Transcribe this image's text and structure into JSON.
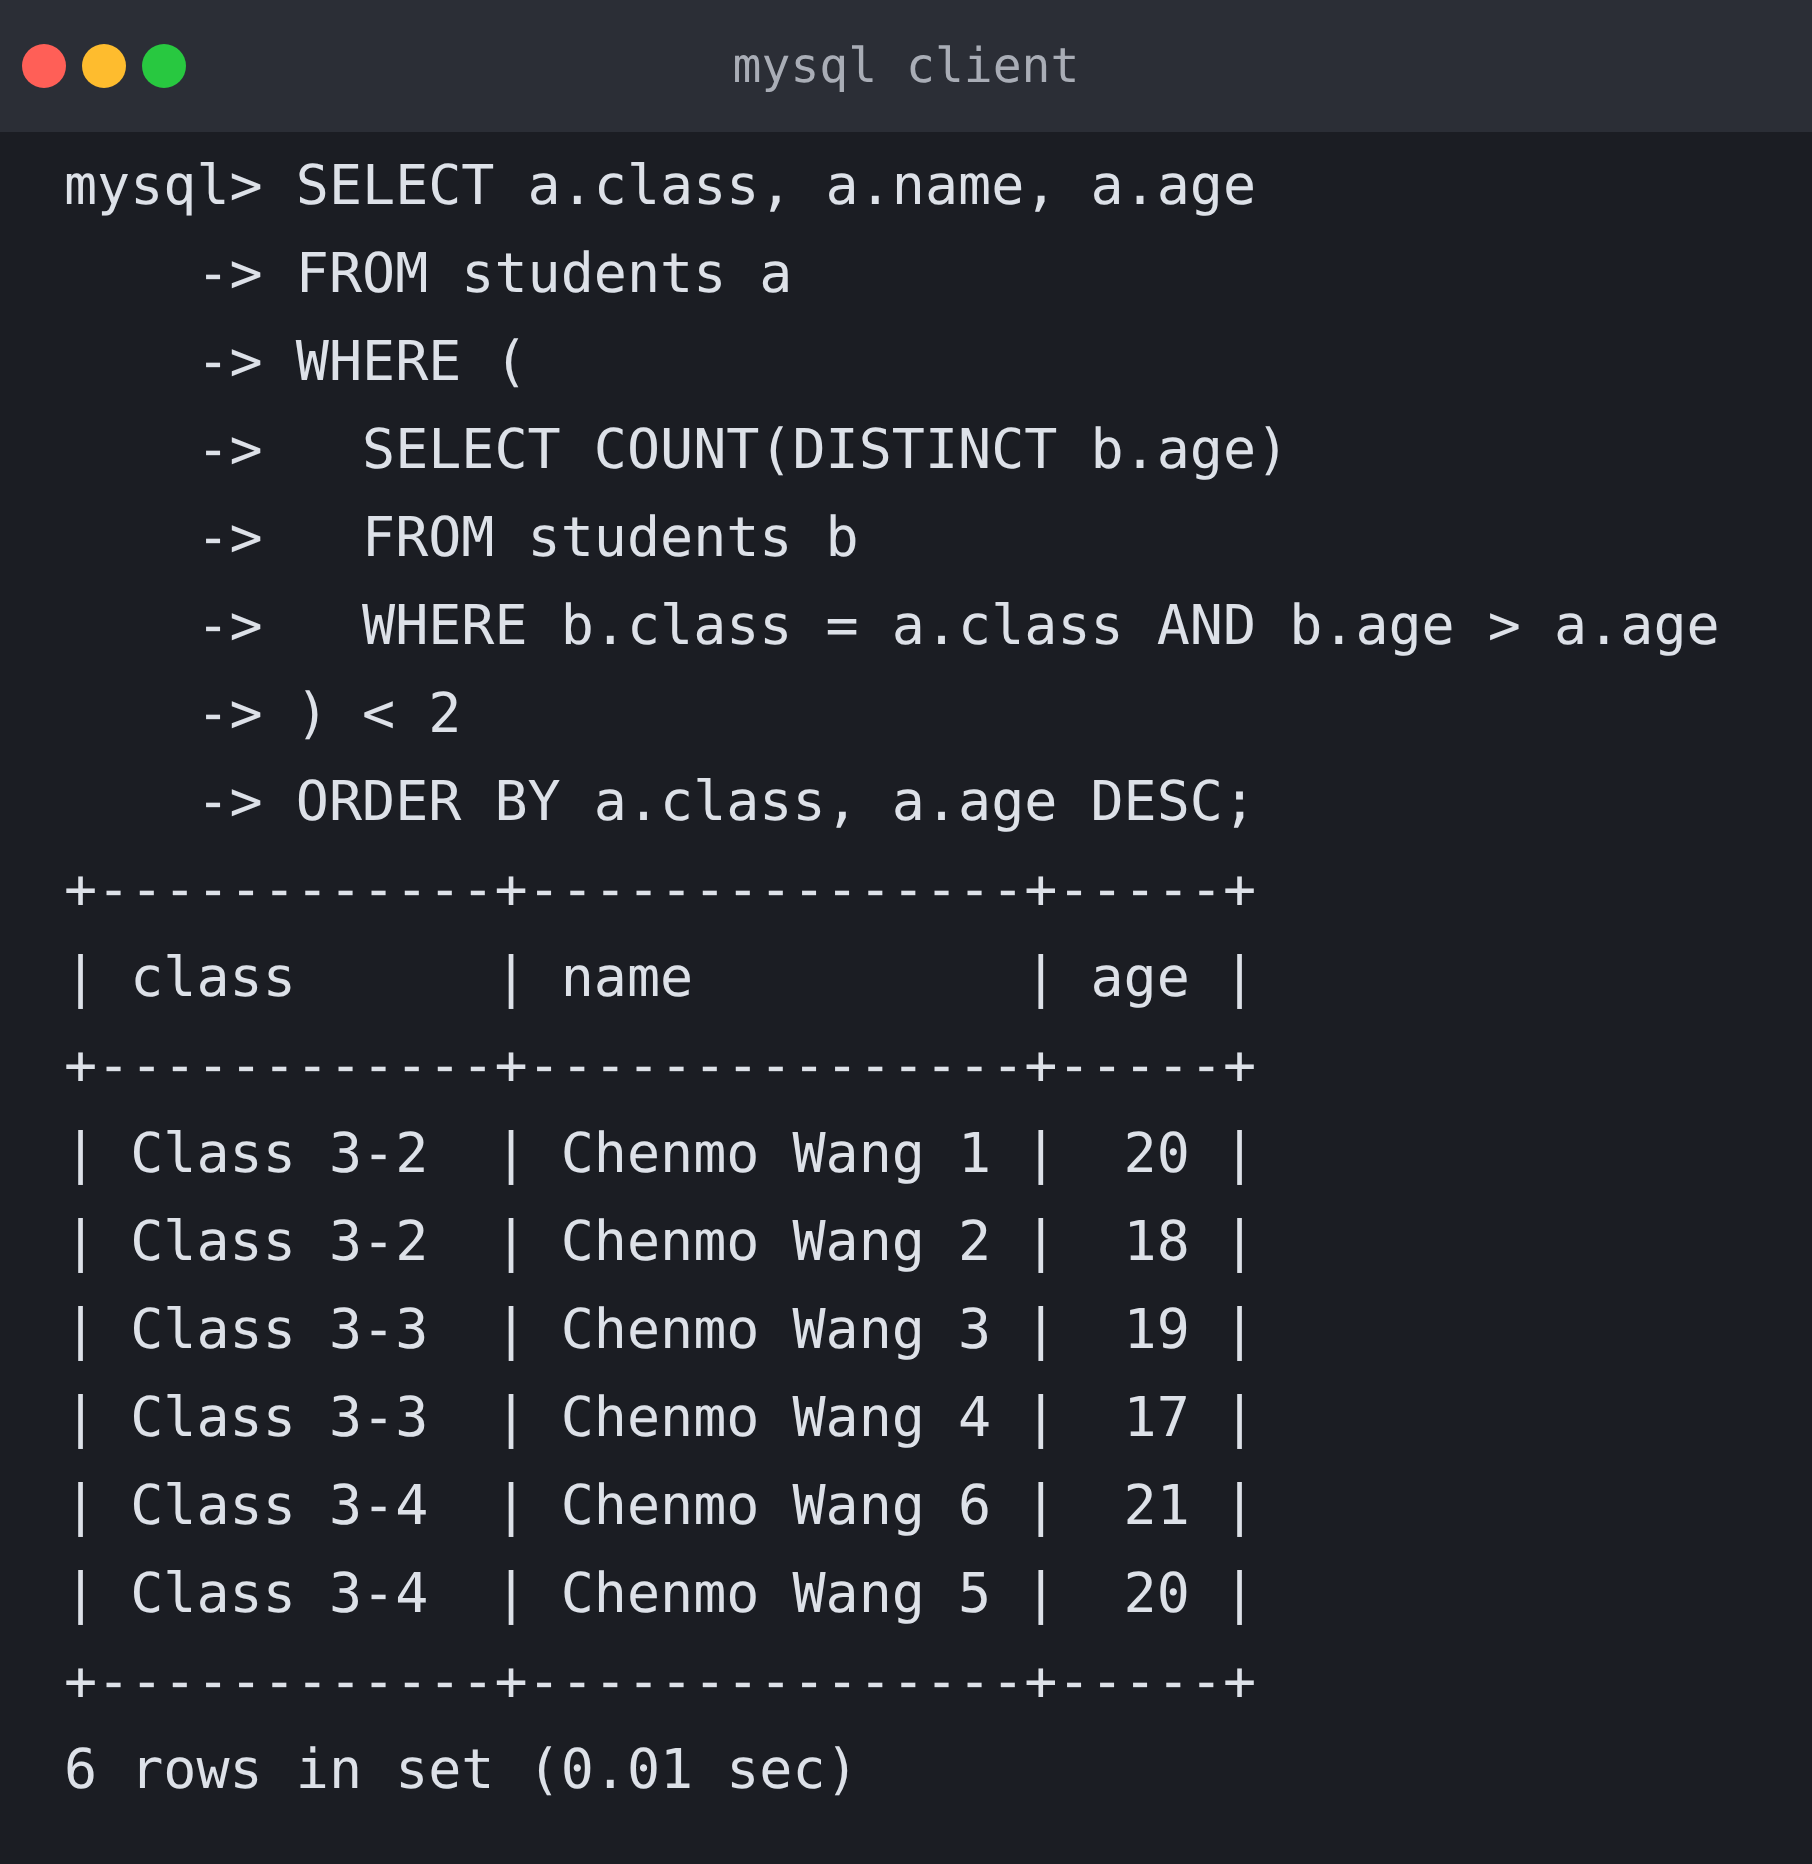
{
  "window": {
    "title": "mysql client"
  },
  "lines": [
    "mysql> SELECT a.class, a.name, a.age",
    "    -> FROM students a",
    "    -> WHERE (",
    "    ->   SELECT COUNT(DISTINCT b.age)",
    "    ->   FROM students b",
    "    ->   WHERE b.class = a.class AND b.age > a.age",
    "    -> ) < 2",
    "    -> ORDER BY a.class, a.age DESC;",
    "+------------+---------------+-----+",
    "| class      | name          | age |",
    "+------------+---------------+-----+",
    "| Class 3-2  | Chenmo Wang 1 |  20 |",
    "| Class 3-2  | Chenmo Wang 2 |  18 |",
    "| Class 3-3  | Chenmo Wang 3 |  19 |",
    "| Class 3-3  | Chenmo Wang 4 |  17 |",
    "| Class 3-4  | Chenmo Wang 6 |  21 |",
    "| Class 3-4  | Chenmo Wang 5 |  20 |",
    "+------------+---------------+-----+",
    "6 rows in set (0.01 sec)"
  ]
}
